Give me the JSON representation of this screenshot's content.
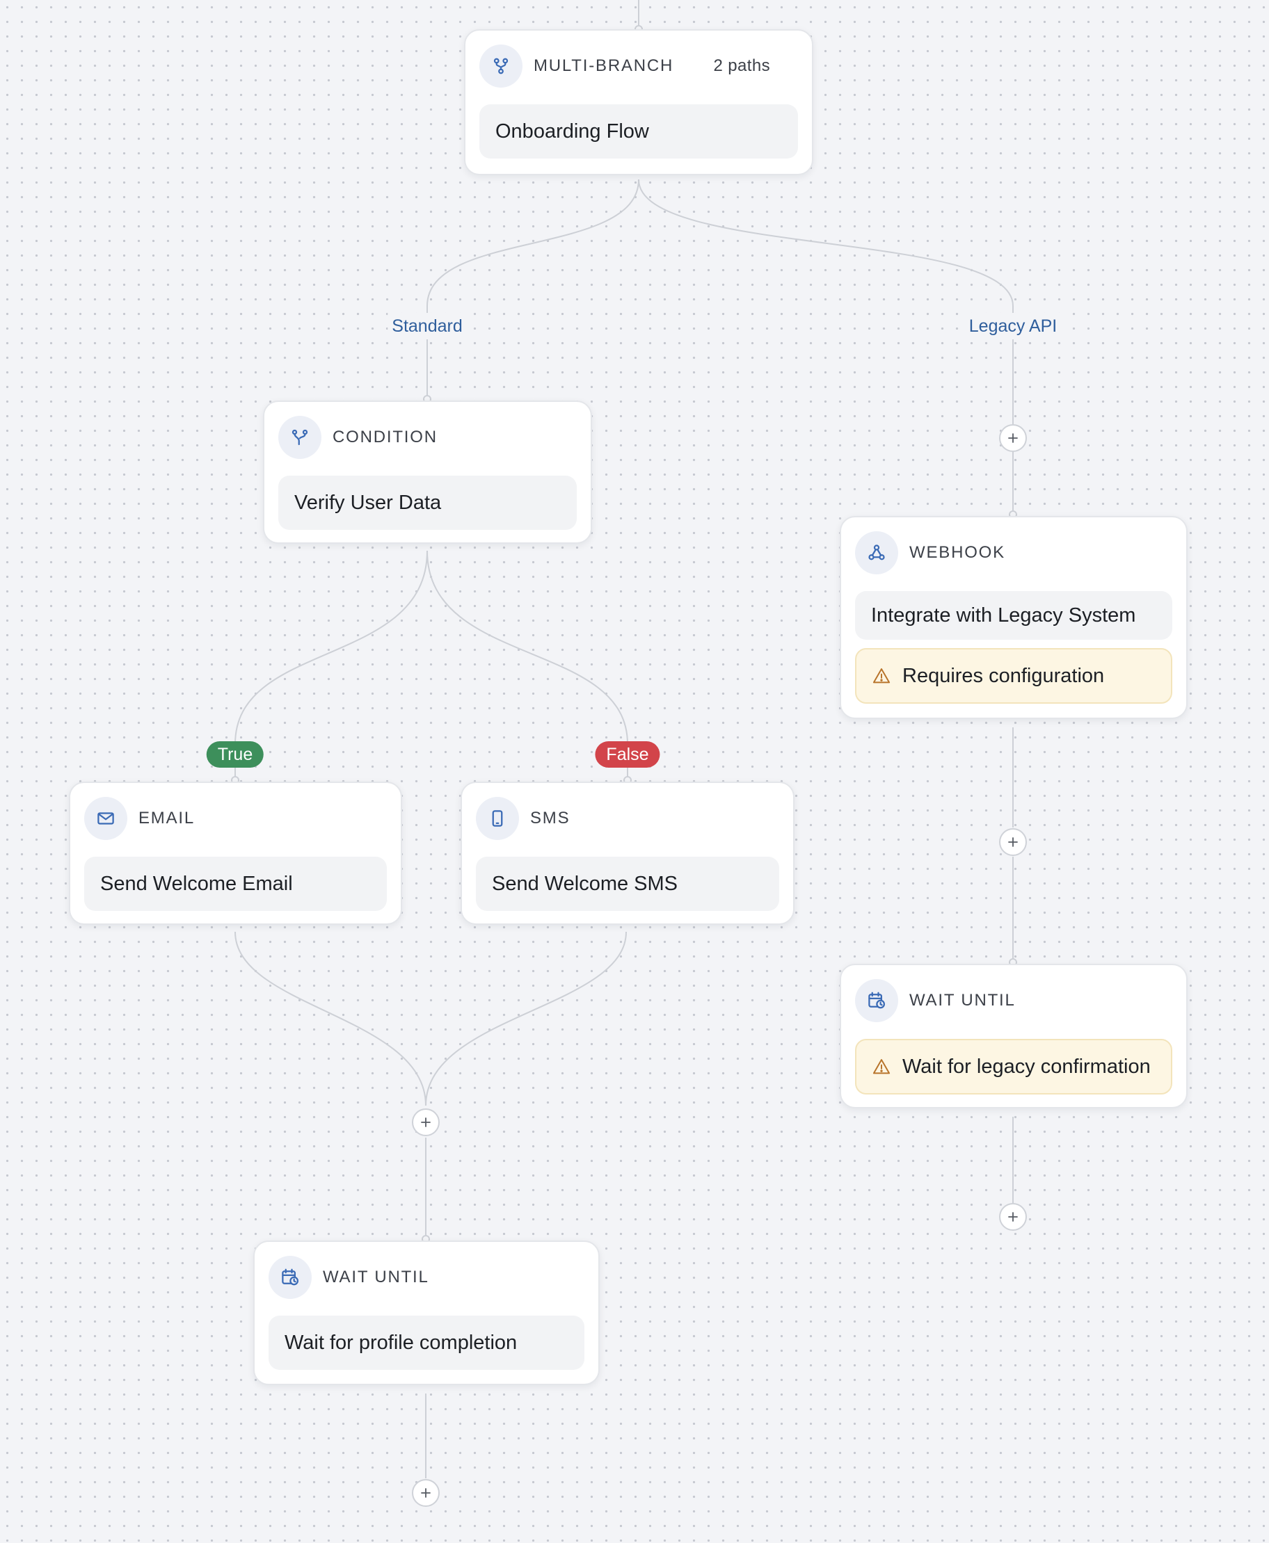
{
  "nodes": {
    "multibranch": {
      "type": "MULTI-BRANCH",
      "meta": "2 paths",
      "title": "Onboarding Flow"
    },
    "condition": {
      "type": "CONDITION",
      "title": "Verify User Data"
    },
    "webhook": {
      "type": "WEBHOOK",
      "title": "Integrate with Legacy System",
      "warning": "Requires configuration"
    },
    "email": {
      "type": "EMAIL",
      "title": "Send Welcome Email"
    },
    "sms": {
      "type": "SMS",
      "title": "Send Welcome SMS"
    },
    "wait_legacy": {
      "type": "WAIT UNTIL",
      "warning": "Wait for legacy confirmation"
    },
    "wait_profile": {
      "type": "WAIT UNTIL",
      "title": "Wait for profile completion"
    }
  },
  "edge_labels": {
    "standard": "Standard",
    "legacy": "Legacy API",
    "true": "True",
    "false": "False"
  },
  "colors": {
    "accent_blue": "#3a6ab5",
    "true_green": "#3d8f5b",
    "false_red": "#d2444a",
    "warning_bg": "#fdf6e3",
    "warning_icon": "#b8742b"
  },
  "icons": {
    "multibranch": "branch-fork-icon",
    "condition": "condition-split-icon",
    "webhook": "webhook-icon",
    "email": "envelope-icon",
    "sms": "smartphone-icon",
    "wait": "calendar-clock-icon",
    "warning": "warning-triangle-icon",
    "add": "plus-icon"
  }
}
